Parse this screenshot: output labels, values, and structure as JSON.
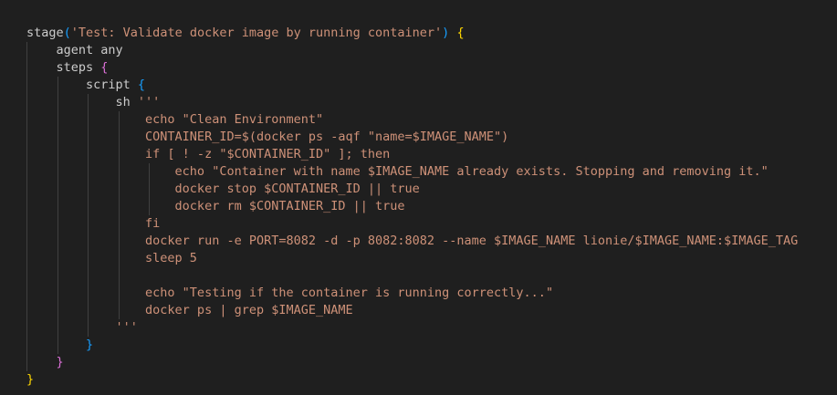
{
  "theme": {
    "background": "#1f1f1f",
    "text": "#cccccc",
    "string": "#ce9178",
    "bracket_level1": "#ffd700",
    "bracket_level2": "#da70d6",
    "bracket_level3": "#179fff"
  },
  "code": {
    "lines": [
      [
        {
          "t": "stage",
          "c": "default"
        },
        {
          "t": "(",
          "c": "paren"
        },
        {
          "t": "'Test: Validate docker image by running container'",
          "c": "string"
        },
        {
          "t": ")",
          "c": "paren"
        },
        {
          "t": " ",
          "c": "default"
        },
        {
          "t": "{",
          "c": "brace-y"
        }
      ],
      [
        {
          "t": "    agent any",
          "c": "default"
        }
      ],
      [
        {
          "t": "    steps ",
          "c": "default"
        },
        {
          "t": "{",
          "c": "brace-p"
        }
      ],
      [
        {
          "t": "        script ",
          "c": "default"
        },
        {
          "t": "{",
          "c": "brace-b"
        }
      ],
      [
        {
          "t": "            sh ",
          "c": "default"
        },
        {
          "t": "'''",
          "c": "string"
        }
      ],
      [
        {
          "t": "                echo \"Clean Environment\"",
          "c": "string"
        }
      ],
      [
        {
          "t": "                CONTAINER_ID=$(docker ps -aqf \"name=$IMAGE_NAME\")",
          "c": "string"
        }
      ],
      [
        {
          "t": "                if [ ! -z \"$CONTAINER_ID\" ]; then",
          "c": "string"
        }
      ],
      [
        {
          "t": "                    echo \"Container with name $IMAGE_NAME already exists. Stopping and removing it.\"",
          "c": "string"
        }
      ],
      [
        {
          "t": "                    docker stop $CONTAINER_ID || true",
          "c": "string"
        }
      ],
      [
        {
          "t": "                    docker rm $CONTAINER_ID || true",
          "c": "string"
        }
      ],
      [
        {
          "t": "                fi",
          "c": "string"
        }
      ],
      [
        {
          "t": "                docker run -e PORT=8082 -d -p 8082:8082 --name $IMAGE_NAME lionie/$IMAGE_NAME:$IMAGE_TAG",
          "c": "string"
        }
      ],
      [
        {
          "t": "                sleep 5",
          "c": "string"
        }
      ],
      [
        {
          "t": "",
          "c": "string"
        }
      ],
      [
        {
          "t": "                echo \"Testing if the container is running correctly...\"",
          "c": "string"
        }
      ],
      [
        {
          "t": "                docker ps | grep $IMAGE_NAME",
          "c": "string"
        }
      ],
      [
        {
          "t": "            '''",
          "c": "string"
        }
      ],
      [
        {
          "t": "        ",
          "c": "default"
        },
        {
          "t": "}",
          "c": "brace-b"
        }
      ],
      [
        {
          "t": "    ",
          "c": "default"
        },
        {
          "t": "}",
          "c": "brace-p"
        }
      ],
      [
        {
          "t": "}",
          "c": "brace-y"
        }
      ]
    ]
  }
}
